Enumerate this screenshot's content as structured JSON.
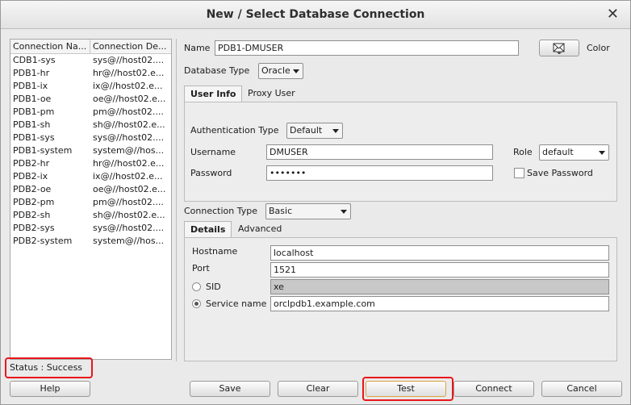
{
  "window": {
    "title": "New / Select Database Connection",
    "close_glyph": "✕"
  },
  "connections": {
    "headers": [
      "Connection Na...",
      "Connection De..."
    ],
    "rows": [
      [
        "CDB1-sys",
        "sys@//host02...."
      ],
      [
        "PDB1-hr",
        "hr@//host02.e..."
      ],
      [
        "PDB1-ix",
        "ix@//host02.e..."
      ],
      [
        "PDB1-oe",
        "oe@//host02.e..."
      ],
      [
        "PDB1-pm",
        "pm@//host02...."
      ],
      [
        "PDB1-sh",
        "sh@//host02.e..."
      ],
      [
        "PDB1-sys",
        "sys@//host02...."
      ],
      [
        "PDB1-system",
        "system@//hos..."
      ],
      [
        "PDB2-hr",
        "hr@//host02.e..."
      ],
      [
        "PDB2-ix",
        "ix@//host02.e..."
      ],
      [
        "PDB2-oe",
        "oe@//host02.e..."
      ],
      [
        "PDB2-pm",
        "pm@//host02...."
      ],
      [
        "PDB2-sh",
        "sh@//host02.e..."
      ],
      [
        "PDB2-sys",
        "sys@//host02...."
      ],
      [
        "PDB2-system",
        "system@//hos..."
      ]
    ]
  },
  "form": {
    "name_label": "Name",
    "name_value": "PDB1-DMUSER",
    "color_label": "Color",
    "db_type_label": "Database Type",
    "db_type_value": "Oracle",
    "tabs": [
      "User Info",
      "Proxy User"
    ],
    "auth_type_label": "Authentication Type",
    "auth_type_value": "Default",
    "username_label": "Username",
    "username_value": "DMUSER",
    "password_label": "Password",
    "password_value": "•••••••",
    "role_label": "Role",
    "role_value": "default",
    "save_password_label": "Save Password",
    "conn_type_label": "Connection Type",
    "conn_type_value": "Basic",
    "detail_tabs": [
      "Details",
      "Advanced"
    ],
    "hostname_label": "Hostname",
    "hostname_value": "localhost",
    "port_label": "Port",
    "port_value": "1521",
    "sid_label": "SID",
    "sid_value": "xe",
    "service_label": "Service name",
    "service_value": "orclpdb1.example.com"
  },
  "status": {
    "text": "Status : Success"
  },
  "buttons": {
    "help": "Help",
    "save": "Save",
    "clear": "Clear",
    "test": "Test",
    "connect": "Connect",
    "cancel": "Cancel"
  },
  "colors": {
    "highlight": "#e8161b"
  }
}
